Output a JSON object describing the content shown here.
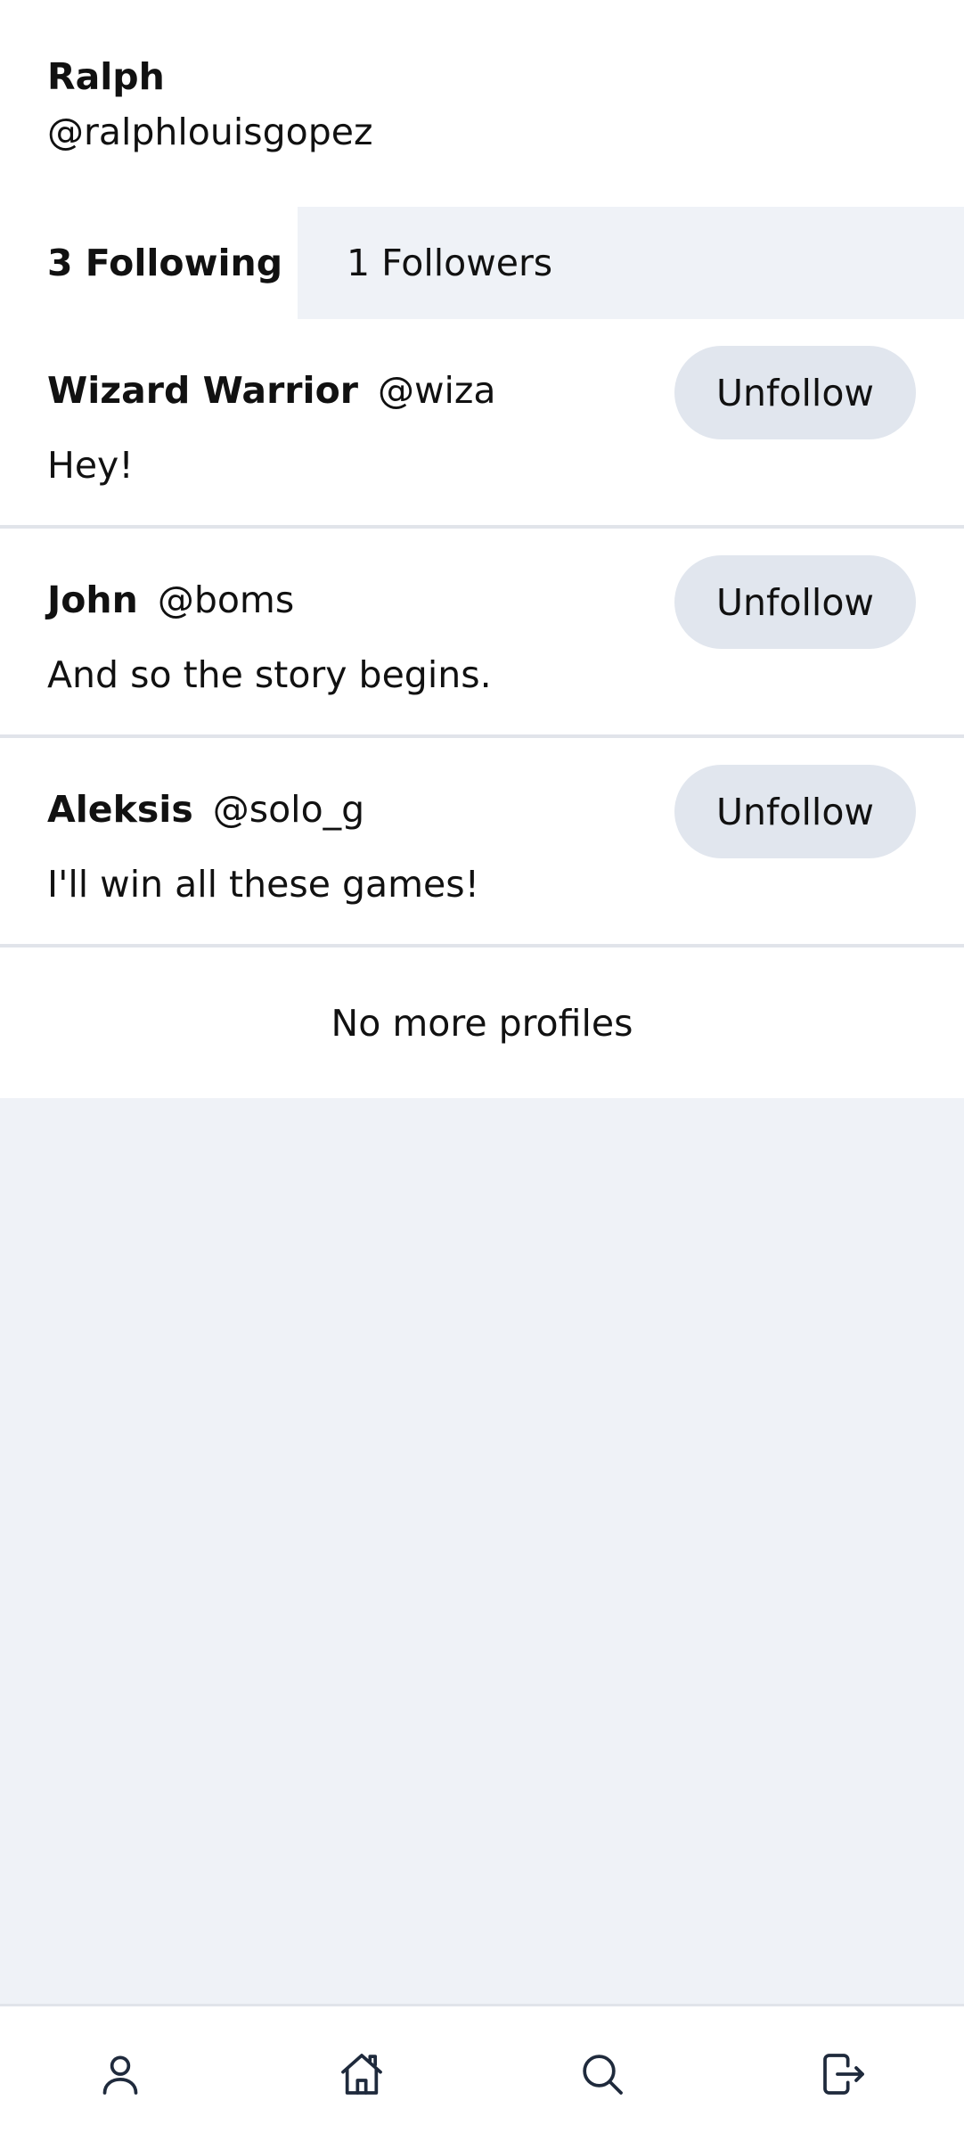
{
  "profile": {
    "name": "Ralph",
    "handle": "@ralphlouisgopez"
  },
  "tabs": {
    "following_label": "3 Following",
    "followers_label": "1 Followers"
  },
  "following": [
    {
      "name": "Wizard Warrior",
      "handle": "@wiza",
      "bio": "Hey!",
      "button_label": "Unfollow"
    },
    {
      "name": "John",
      "handle": "@boms",
      "bio": "And so the story begins.",
      "button_label": "Unfollow"
    },
    {
      "name": "Aleksis",
      "handle": "@solo_g",
      "bio": "I'll win all these games!",
      "button_label": "Unfollow"
    }
  ],
  "list_end_text": "No more profiles",
  "bottom_nav": {
    "items": [
      {
        "icon": "profile-icon"
      },
      {
        "icon": "home-icon"
      },
      {
        "icon": "search-icon"
      },
      {
        "icon": "logout-icon"
      }
    ]
  },
  "colors": {
    "background": "#eff2f7",
    "button": "#e1e6ee",
    "divider": "#e1e4ea",
    "icon": "#1f2a3c"
  }
}
